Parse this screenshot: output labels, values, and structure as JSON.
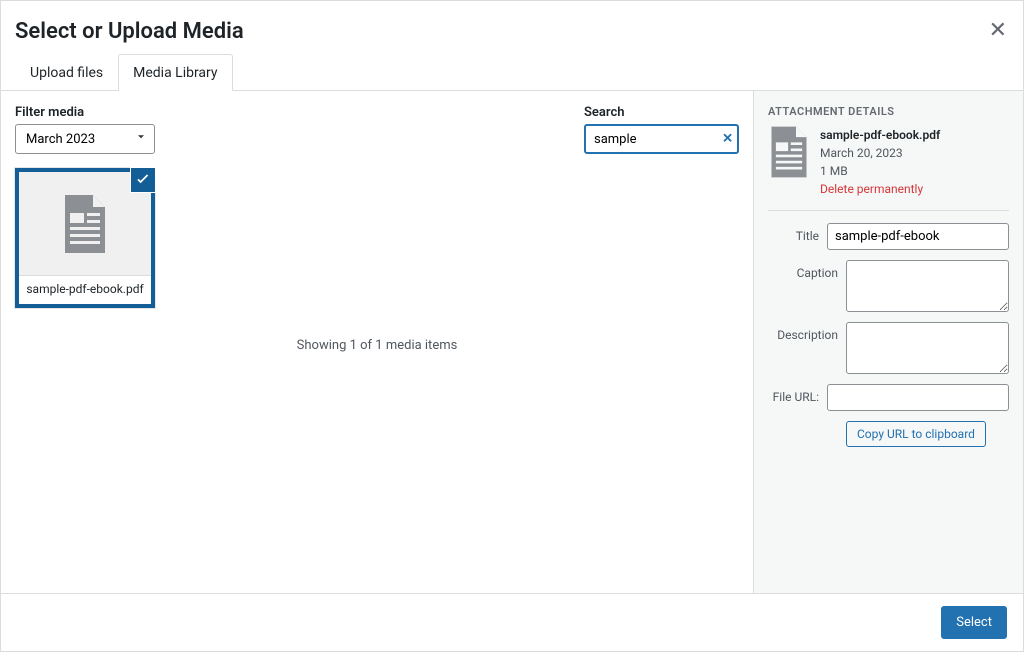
{
  "modal": {
    "title": "Select or Upload Media",
    "close_label": "Close"
  },
  "tabs": {
    "upload": "Upload files",
    "library": "Media Library"
  },
  "toolbar": {
    "filter_label": "Filter media",
    "filter_value": "March 2023",
    "search_label": "Search",
    "search_value": "sample"
  },
  "attachments": {
    "items": [
      {
        "filename": "sample-pdf-ebook.pdf",
        "selected": true
      }
    ],
    "status": "Showing 1 of 1 media items"
  },
  "details": {
    "heading": "ATTACHMENT DETAILS",
    "filename": "sample-pdf-ebook.pdf",
    "date": "March 20, 2023",
    "size": "1 MB",
    "delete_label": "Delete permanently",
    "fields": {
      "title_label": "Title",
      "title_value": "sample-pdf-ebook",
      "caption_label": "Caption",
      "caption_value": "",
      "description_label": "Description",
      "description_value": "",
      "file_url_label": "File URL:",
      "file_url_value": ""
    },
    "copy_label": "Copy URL to clipboard"
  },
  "footer": {
    "select_label": "Select"
  }
}
